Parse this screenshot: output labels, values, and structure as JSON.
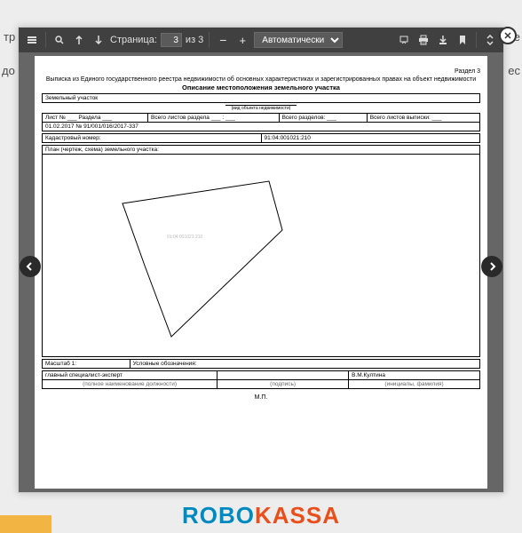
{
  "bg": {
    "t1": "тр",
    "t2": "не",
    "t3": "до",
    "t4": "ес"
  },
  "toolbar": {
    "page_label": "Страница:",
    "current_page": "3",
    "total_pages": "из 3",
    "zoom_mode": "Автоматически"
  },
  "doc": {
    "section": "Раздел 3",
    "title_line1": "Выписка из Единого государственного реестра недвижимости об основных характеристиках и зарегистрированных правах на объект недвижимости",
    "title_line2": "Описание местоположения земельного участка",
    "object_type": "Земельный участок",
    "sub_caption": "(вид объекта недвижимости)",
    "sheet_row": {
      "c1": "Лист № ___ Раздела  ___",
      "c2": "Всего листов раздела ___ : ___",
      "c3": "Всего разделов: ___",
      "c4": "Всего листов выписки: ___"
    },
    "date_num": "01.02.2017 № 91/001/016/2017-337",
    "cad_label": "Кадастровый номер:",
    "cad_value": "91:04:001021:210",
    "plan_header": "План (чертеж, схема) земельного участка:",
    "plan_inner_code": "91:04:001021:210",
    "scale_label": "Масштаб 1:",
    "legend_label": "Условные обозначения:",
    "signer_role": "главный специалист-эксперт",
    "signer_name": "В.М.Култина",
    "sig_c1": "(полное наименование должности)",
    "sig_c2": "(подпись)",
    "sig_c3": "(инициалы, фамилия)",
    "mp": "М.П."
  },
  "footer": {
    "brand1": "ROBO",
    "brand2": "KASSA"
  }
}
